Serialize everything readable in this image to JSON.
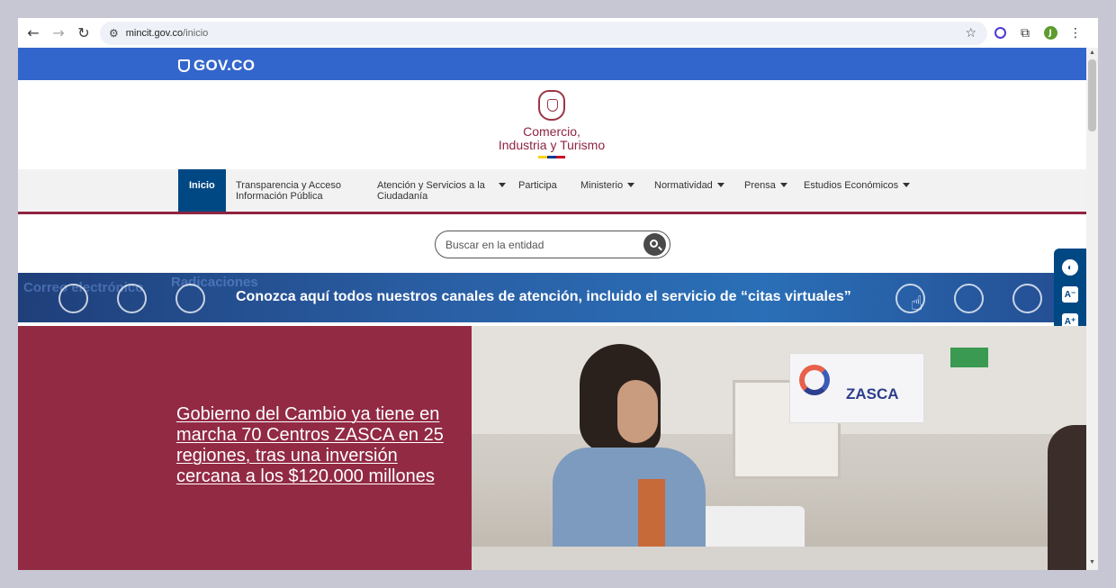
{
  "browser": {
    "url_host": "mincit.gov.co",
    "url_path": "/inicio",
    "profile_initial": "J"
  },
  "gov": {
    "logo_text": "GOV.CO"
  },
  "brand": {
    "line1": "Comercio,",
    "line2": "Industria y Turismo",
    "colors": [
      "#fcd116",
      "#003893",
      "#ce1126"
    ]
  },
  "nav": {
    "items": [
      {
        "label": "Inicio"
      },
      {
        "label": "Transparencia y Acceso Información Pública"
      },
      {
        "label": "Atención y Servicios a la Ciudadanía"
      },
      {
        "label": "Participa"
      },
      {
        "label": "Ministerio"
      },
      {
        "label": "Normatividad"
      },
      {
        "label": "Prensa"
      },
      {
        "label": "Estudios Económicos"
      }
    ]
  },
  "search": {
    "placeholder": "Buscar en la entidad"
  },
  "banner": {
    "text": "Conozca aquí todos nuestros canales de atención, incluido el servicio de “citas virtuales”"
  },
  "accessibility": {
    "increase_text": "A⁺",
    "decrease_text": "A⁻"
  },
  "featured": {
    "headline": "Gobierno del Cambio ya tiene en marcha 70 Centros ZASCA en 25 regiones, tras una inversión cercana a los $120.000 millones"
  },
  "photo": {
    "sign_text": "ZASCA"
  }
}
